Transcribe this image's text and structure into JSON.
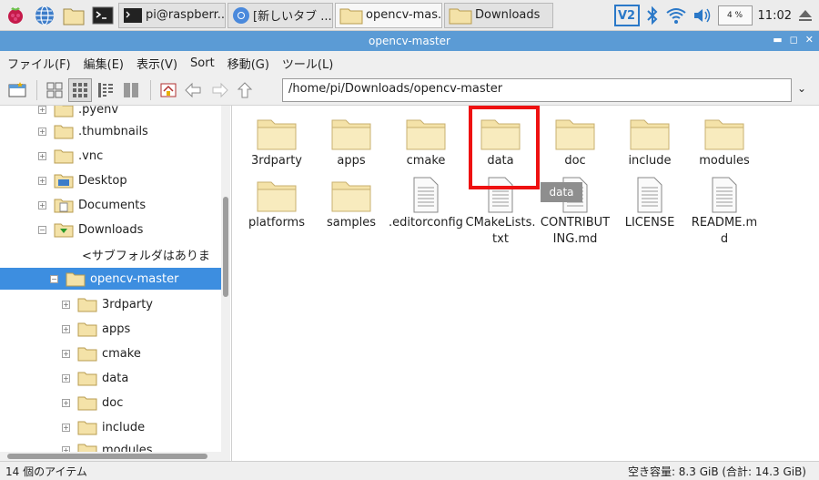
{
  "taskbar": {
    "tasks": [
      {
        "label": "pi@raspberr..."
      },
      {
        "label": "[新しいタブ ..."
      },
      {
        "label": "opencv-mas..."
      },
      {
        "label": "Downloads"
      }
    ],
    "cpu_label": "4 %",
    "clock": "11:02",
    "vnc_label": "V2"
  },
  "window": {
    "title": "opencv-master"
  },
  "menu": [
    "ファイル(F)",
    "編集(E)",
    "表示(V)",
    "Sort",
    "移動(G)",
    "ツール(L)"
  ],
  "address": {
    "path": "/home/pi/Downloads/opencv-master"
  },
  "sidebar": {
    "items": [
      {
        "label": ".pyenv",
        "level": 1,
        "type": "folder"
      },
      {
        "label": ".thumbnails",
        "level": 1,
        "type": "folder"
      },
      {
        "label": ".vnc",
        "level": 1,
        "type": "folder"
      },
      {
        "label": "Desktop",
        "level": 1,
        "type": "desktop"
      },
      {
        "label": "Documents",
        "level": 1,
        "type": "documents"
      },
      {
        "label": "Downloads",
        "level": 1,
        "type": "downloads"
      },
      {
        "label": "<サブフォルダはありま",
        "level": 2,
        "type": "note"
      },
      {
        "label": "opencv-master",
        "level": 2,
        "type": "folder",
        "selected": true
      },
      {
        "label": "3rdparty",
        "level": 3,
        "type": "folder"
      },
      {
        "label": "apps",
        "level": 3,
        "type": "folder"
      },
      {
        "label": "cmake",
        "level": 3,
        "type": "folder"
      },
      {
        "label": "data",
        "level": 3,
        "type": "folder"
      },
      {
        "label": "doc",
        "level": 3,
        "type": "folder"
      },
      {
        "label": "include",
        "level": 3,
        "type": "folder"
      },
      {
        "label": "modules",
        "level": 3,
        "type": "folder"
      }
    ]
  },
  "files": [
    {
      "name": "3rdparty",
      "type": "folder"
    },
    {
      "name": "apps",
      "type": "folder"
    },
    {
      "name": "cmake",
      "type": "folder"
    },
    {
      "name": "data",
      "type": "folder",
      "highlighted": true
    },
    {
      "name": "doc",
      "type": "folder"
    },
    {
      "name": "include",
      "type": "folder"
    },
    {
      "name": "modules",
      "type": "folder"
    },
    {
      "name": "platforms",
      "type": "folder"
    },
    {
      "name": "samples",
      "type": "folder"
    },
    {
      "name": ".editorconfig",
      "type": "file"
    },
    {
      "name": "CMakeLists.txt",
      "display": "CMakeLists.\ntxt",
      "type": "file"
    },
    {
      "name": "CONTRIBUTING.md",
      "display": "CONTRIBUT\nING.md",
      "type": "file"
    },
    {
      "name": "LICENSE",
      "type": "file"
    },
    {
      "name": "README.md",
      "display": "README.m\nd",
      "type": "file"
    }
  ],
  "tooltip": {
    "text": "data"
  },
  "status": {
    "count": "14 個のアイテム",
    "space": "空き容量: 8.3 GiB (合計: 14.3 GiB)"
  },
  "colors": {
    "title_bar": "#5b9bd5",
    "selection": "#3d8ee0",
    "folder": "#f4e2a8",
    "highlight_box": "#ee1111"
  }
}
